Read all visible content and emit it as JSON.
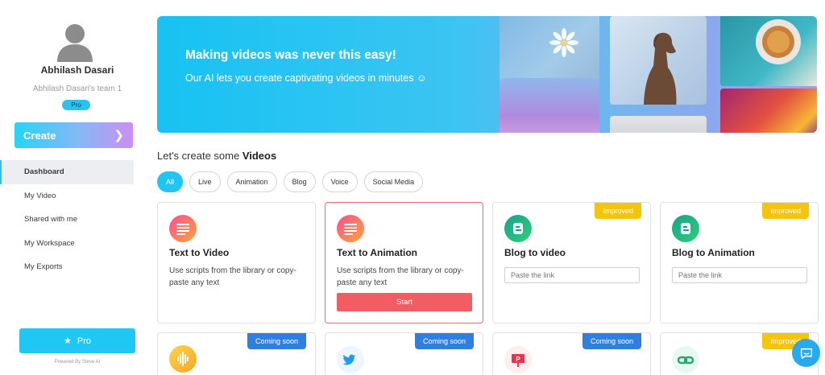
{
  "sidebar": {
    "user_name": "Abhilash Dasari",
    "team_name": "Abhilash Dasari's team 1",
    "plan_badge": "Pro",
    "create_label": "Create",
    "nav": [
      {
        "label": "Dashboard",
        "active": true
      },
      {
        "label": "My Video",
        "active": false
      },
      {
        "label": "Shared with me",
        "active": false
      },
      {
        "label": "My Workspace",
        "active": false
      },
      {
        "label": "My Exports",
        "active": false
      }
    ],
    "pro_button": "Pro",
    "powered_by": "Powered By Steve AI"
  },
  "hero": {
    "title": "Making videos was never this easy!",
    "subtitle": "Our AI lets you create captivating videos in minutes ☺"
  },
  "section": {
    "prefix": "Let's create some ",
    "emphasis": "Videos",
    "filters": [
      "All",
      "Live",
      "Animation",
      "Blog",
      "Voice",
      "Social Media"
    ],
    "active_filter": "All"
  },
  "cards": [
    {
      "title": "Text to Video",
      "description": "Use scripts from the library or copy-paste any text"
    },
    {
      "title": "Text to Animation",
      "description": "Use scripts from the library or copy-paste any text",
      "action": "Start"
    },
    {
      "title": "Blog to video",
      "badge": "Improved",
      "placeholder": "Paste the link"
    },
    {
      "title": "Blog to Animation",
      "badge": "Improved",
      "placeholder": "Paste the link"
    }
  ],
  "cards_row2": [
    {
      "badge": "Coming soon",
      "icon": "audio-wave-icon"
    },
    {
      "badge": "Coming soon",
      "icon": "twitter-icon"
    },
    {
      "badge": "Coming soon",
      "icon": "presentation-icon"
    },
    {
      "badge": "Improved",
      "icon": "link-icon"
    }
  ],
  "colors": {
    "accent": "#1fc6f2",
    "start_button": "#f25c63",
    "improved_badge": "#f5c50d",
    "coming_soon_badge": "#2f7fe0"
  }
}
